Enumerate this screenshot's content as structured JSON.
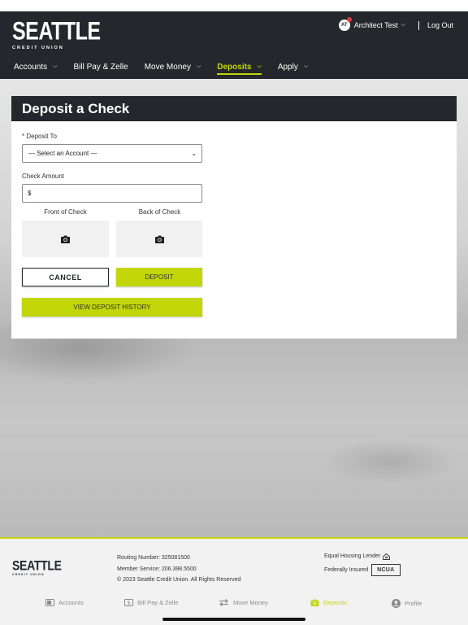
{
  "colors": {
    "accent": "#c2d60a",
    "header_bg": "#24272b",
    "card_bg": "#ffffff"
  },
  "brand": {
    "logo_main": "SEATTLE",
    "logo_sub": "CREDIT UNION"
  },
  "user": {
    "initials": "AT",
    "name": "Architect Test",
    "logout": "Log Out"
  },
  "nav": [
    {
      "label": "Accounts",
      "has_chevron": true,
      "active": false
    },
    {
      "label": "Bill Pay & Zelle",
      "has_chevron": false,
      "active": false
    },
    {
      "label": "Move Money",
      "has_chevron": true,
      "active": false
    },
    {
      "label": "Deposits",
      "has_chevron": true,
      "active": true
    },
    {
      "label": "Apply",
      "has_chevron": true,
      "active": false
    }
  ],
  "deposit_card": {
    "title": "Deposit a Check",
    "deposit_to_label": "* Deposit To",
    "deposit_to_value": "— Select an Account —",
    "amount_label": "Check Amount",
    "amount_prefix": "$",
    "front_label": "Front of Check",
    "back_label": "Back of Check",
    "cancel": "CANCEL",
    "deposit": "DEPOSIT",
    "history": "VIEW DEPOSIT HISTORY"
  },
  "footer": {
    "logo_main": "SEATTLE",
    "logo_sub": "CREDIT UNION",
    "routing": "Routing Number: 325081500",
    "member_service": "Member Service: 206.398.5500",
    "copyright": "© 2023 Seattle Credit Union. All Rights Reserved",
    "equal_housing": "Equal Housing Lender",
    "federally_insured": "Federally Insured",
    "ncua": "NCUA"
  },
  "tabbar": [
    {
      "label": "Accounts",
      "icon": "wallet-icon",
      "active": false
    },
    {
      "label": "Bill Pay & Zelle",
      "icon": "dollar-bill-icon",
      "active": false
    },
    {
      "label": "Move Money",
      "icon": "transfer-arrows-icon",
      "active": false
    },
    {
      "label": "Deposits",
      "icon": "camera-icon",
      "active": true
    },
    {
      "label": "Profile",
      "icon": "user-circle-icon",
      "active": false
    }
  ]
}
